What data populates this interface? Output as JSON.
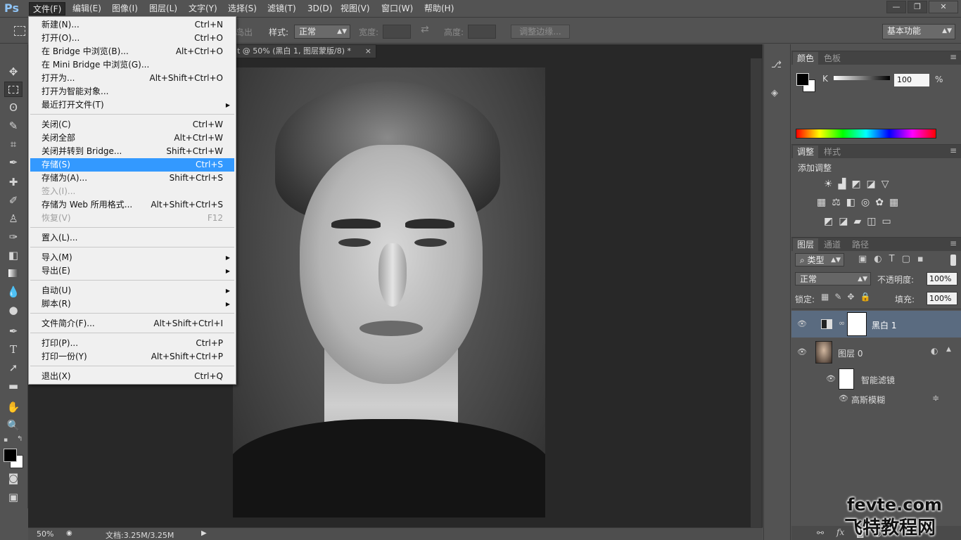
{
  "menubar": {
    "logo": "Ps",
    "items": [
      "文件(F)",
      "编辑(E)",
      "图像(I)",
      "图层(L)",
      "文字(Y)",
      "选择(S)",
      "滤镜(T)",
      "3D(D)",
      "视图(V)",
      "窗口(W)",
      "帮助(H)"
    ],
    "window_buttons": [
      "—",
      "❐",
      "✕"
    ]
  },
  "options": {
    "partial_label": "岛出",
    "style_label": "样式:",
    "style_value": "正常",
    "width_label": "宽度:",
    "height_label": "高度:",
    "refine_button": "调整边缘...",
    "workspace": "基本功能"
  },
  "document": {
    "tab_title": "t @ 50% (黑白 1, 图层蒙版/8) *",
    "tab_close": "×",
    "zoom": "50%",
    "doc_info": "文档:3.25M/3.25M"
  },
  "file_menu": {
    "items": [
      {
        "label": "新建(N)...",
        "shortcut": "Ctrl+N"
      },
      {
        "label": "打开(O)...",
        "shortcut": "Ctrl+O"
      },
      {
        "label": "在 Bridge 中浏览(B)...",
        "shortcut": "Alt+Ctrl+O"
      },
      {
        "label": "在 Mini Bridge 中浏览(G)...",
        "shortcut": ""
      },
      {
        "label": "打开为...",
        "shortcut": "Alt+Shift+Ctrl+O"
      },
      {
        "label": "打开为智能对象...",
        "shortcut": ""
      },
      {
        "label": "最近打开文件(T)",
        "shortcut": "",
        "submenu": true
      },
      {
        "label": "关闭(C)",
        "shortcut": "Ctrl+W"
      },
      {
        "label": "关闭全部",
        "shortcut": "Alt+Ctrl+W"
      },
      {
        "label": "关闭并转到 Bridge...",
        "shortcut": "Shift+Ctrl+W"
      },
      {
        "label": "存储(S)",
        "shortcut": "Ctrl+S",
        "highlighted": true
      },
      {
        "label": "存储为(A)...",
        "shortcut": "Shift+Ctrl+S"
      },
      {
        "label": "签入(I)...",
        "shortcut": "",
        "disabled": true
      },
      {
        "label": "存储为 Web 所用格式...",
        "shortcut": "Alt+Shift+Ctrl+S"
      },
      {
        "label": "恢复(V)",
        "shortcut": "F12",
        "disabled": true
      },
      {
        "label": "置入(L)...",
        "shortcut": ""
      },
      {
        "label": "导入(M)",
        "shortcut": "",
        "submenu": true
      },
      {
        "label": "导出(E)",
        "shortcut": "",
        "submenu": true
      },
      {
        "label": "自动(U)",
        "shortcut": "",
        "submenu": true
      },
      {
        "label": "脚本(R)",
        "shortcut": "",
        "submenu": true
      },
      {
        "label": "文件简介(F)...",
        "shortcut": "Alt+Shift+Ctrl+I"
      },
      {
        "label": "打印(P)...",
        "shortcut": "Ctrl+P"
      },
      {
        "label": "打印一份(Y)",
        "shortcut": "Alt+Shift+Ctrl+P"
      },
      {
        "label": "退出(X)",
        "shortcut": "Ctrl+Q"
      }
    ]
  },
  "color_panel": {
    "tabs": [
      "颜色",
      "色板"
    ],
    "channel": "K",
    "value": "100",
    "unit": "%"
  },
  "adjust_panel": {
    "tabs": [
      "调整",
      "样式"
    ],
    "title": "添加调整"
  },
  "layers_panel": {
    "tabs": [
      "图层",
      "通道",
      "路径"
    ],
    "filter_kind": "类型",
    "blend_mode": "正常",
    "opacity_label": "不透明度:",
    "opacity_value": "100%",
    "lock_label": "锁定:",
    "fill_label": "填充:",
    "fill_value": "100%",
    "layers": [
      {
        "name": "黑白 1",
        "selected": true
      },
      {
        "name": "图层 0",
        "selected": false
      },
      {
        "name": "智能滤镜",
        "selected": false
      },
      {
        "name": "高斯模糊",
        "selected": false
      }
    ]
  },
  "watermark": {
    "line1": "fevte.com",
    "line2": "飞特教程网"
  }
}
